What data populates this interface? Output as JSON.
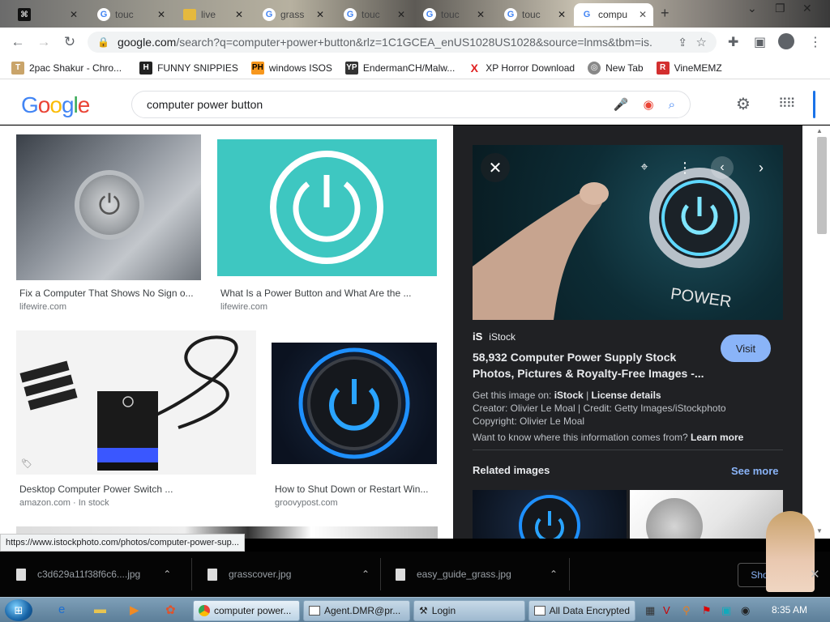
{
  "tabs": [
    {
      "label": "",
      "icon": "capcut-icon"
    },
    {
      "label": "touc",
      "icon": "google-icon"
    },
    {
      "label": "live",
      "icon": "folder-icon"
    },
    {
      "label": "grass",
      "icon": "google-icon"
    },
    {
      "label": "touc",
      "icon": "google-icon"
    },
    {
      "label": "touc",
      "icon": "google-icon"
    },
    {
      "label": "touc",
      "icon": "google-icon"
    },
    {
      "label": "compu",
      "icon": "google-icon"
    }
  ],
  "address": {
    "domain": "google.com",
    "path": "/search?q=computer+power+button&rlz=1C1GCEA_enUS1028US1028&source=lnms&tbm=is..."
  },
  "bookmarks": [
    {
      "label": "2pac Shakur - Chro...",
      "icon": "T",
      "color": "#c9a46a"
    },
    {
      "label": "FUNNY SNIPPIES",
      "icon": "H",
      "color": "#222222"
    },
    {
      "label": "windows ISOS",
      "icon": "PH",
      "color": "#f7971d"
    },
    {
      "label": "EndermanCH/Malw...",
      "icon": "YP",
      "color": "#333333"
    },
    {
      "label": "XP Horror Download",
      "icon": "X",
      "color": "#e02020"
    },
    {
      "label": "New Tab",
      "icon": "◎",
      "color": "#888888"
    },
    {
      "label": "VineMEMZ",
      "icon": "R",
      "color": "#d32f2f"
    }
  ],
  "search": {
    "query": "computer power button"
  },
  "results": [
    {
      "caption": "Fix a Computer That Shows No Sign o...",
      "source": "lifewire.com"
    },
    {
      "caption": "What Is a Power Button and What Are the ...",
      "source": "lifewire.com"
    },
    {
      "caption": "Desktop Computer Power Switch ...",
      "source": "amazon.com · In stock"
    },
    {
      "caption": "How to Shut Down or Restart Win...",
      "source": "groovypost.com"
    }
  ],
  "preview": {
    "image_label": "POWER",
    "site": "iStock",
    "title": "58,932 Computer Power Supply Stock Photos, Pictures & Royalty-Free Images -...",
    "visit": "Visit",
    "get_image_prefix": "Get this image on: ",
    "get_image_site": "iStock",
    "license_sep": " | ",
    "license": "License details",
    "creator": "Creator: Olivier Le Moal | Credit: Getty Images/iStockphoto",
    "copyright": "Copyright: Olivier Le Moal",
    "want_to_know": "Want to know where this information comes from? ",
    "learn_more": "Learn more",
    "related": "Related images",
    "see_more": "See more"
  },
  "status_url": "https://www.istockphoto.com/photos/computer-power-sup...",
  "downloads": [
    {
      "name": "c3d629a11f38f6c6....jpg"
    },
    {
      "name": "grasscover.jpg"
    },
    {
      "name": "easy_guide_grass.jpg"
    }
  ],
  "show_all": "Show all",
  "taskbar": {
    "tasks": [
      {
        "label": "computer power...",
        "icon": "chrome-icon"
      },
      {
        "label": "Agent.DMR@pr...",
        "icon": "window-icon"
      },
      {
        "label": "Login",
        "icon": "login-icon"
      },
      {
        "label": "All Data Encrypted",
        "icon": "window-icon"
      }
    ],
    "clock": "8:35 AM"
  },
  "colors": {
    "accent": "#1a73e8",
    "visit": "#8ab4f8",
    "panel": "#202124"
  }
}
